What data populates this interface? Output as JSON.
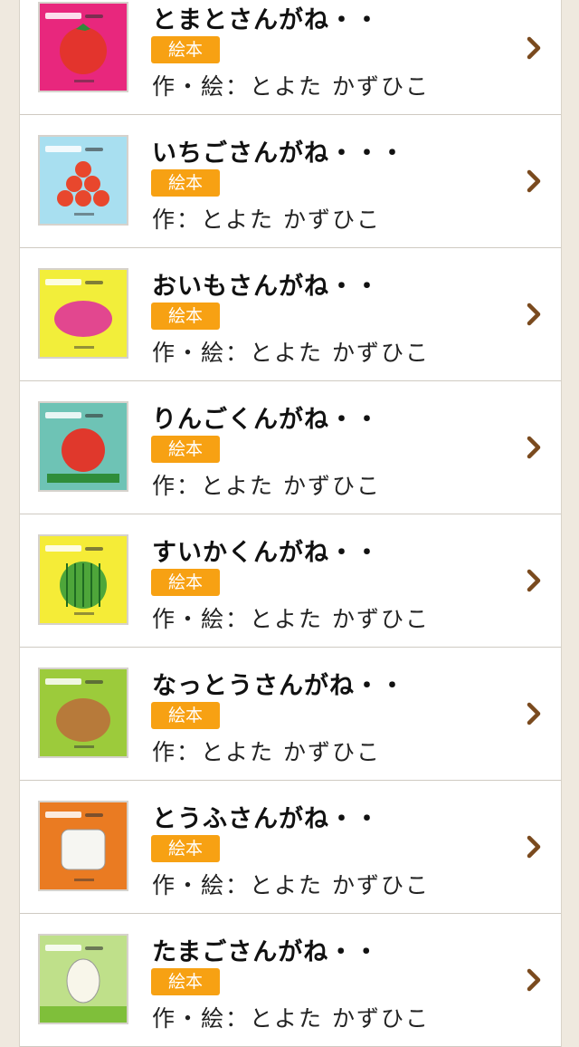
{
  "books": [
    {
      "title": "とまとさんがね・・",
      "badge": "絵本",
      "author": "作・絵：とよた かずひこ",
      "cover": {
        "name": "tomato-cover",
        "bg": "#e8277d",
        "art": "#e3342d"
      }
    },
    {
      "title": "いちごさんがね・・・",
      "badge": "絵本",
      "author": "作：とよた かずひこ",
      "cover": {
        "name": "strawberry-cover",
        "bg": "#a8dff0",
        "art": "#e8472d"
      }
    },
    {
      "title": "おいもさんがね・・",
      "badge": "絵本",
      "author": "作・絵：とよた かずひこ",
      "cover": {
        "name": "sweet-potato-cover",
        "bg": "#f2ee3a",
        "art": "#e2478f"
      }
    },
    {
      "title": "りんごくんがね・・",
      "badge": "絵本",
      "author": "作：とよた かずひこ",
      "cover": {
        "name": "apple-cover",
        "bg": "#6ec3b5",
        "art": "#e0382c"
      }
    },
    {
      "title": "すいかくんがね・・",
      "badge": "絵本",
      "author": "作・絵：とよた かずひこ",
      "cover": {
        "name": "watermelon-cover",
        "bg": "#f5ec37",
        "art": "#4ea63a"
      }
    },
    {
      "title": "なっとうさんがね・・",
      "badge": "絵本",
      "author": "作：とよた かずひこ",
      "cover": {
        "name": "natto-cover",
        "bg": "#9ccb3b",
        "art": "#b77a3a"
      }
    },
    {
      "title": "とうふさんがね・・",
      "badge": "絵本",
      "author": "作・絵：とよた かずひこ",
      "cover": {
        "name": "tofu-cover",
        "bg": "#ea7b22",
        "art": "#f6f6f2"
      }
    },
    {
      "title": "たまごさんがね・・",
      "badge": "絵本",
      "author": "作・絵：とよた かずひこ",
      "cover": {
        "name": "egg-cover",
        "bg": "#bfe08a",
        "art": "#f8f6ea"
      }
    }
  ],
  "chevron_icon": "chevron-right-icon",
  "colors": {
    "badge": "#f7a113",
    "chevron": "#7a4a1e",
    "background": "#efe9df"
  }
}
